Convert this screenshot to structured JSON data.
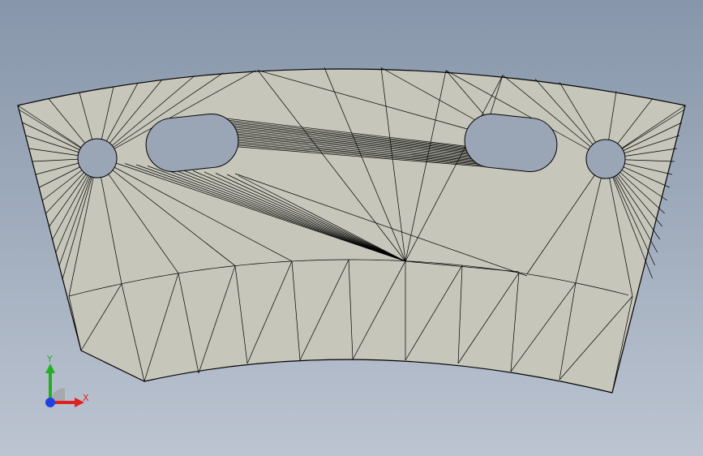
{
  "colors": {
    "background_top": "#8796aa",
    "background_bottom": "#bcc4d1",
    "part_face": "#c6c6bb",
    "mesh_edge": "#000000",
    "axis_x": "#e02020",
    "axis_y": "#20b020",
    "axis_z": "#2040e0"
  },
  "triad": {
    "x_label": "X",
    "y_label": "Y"
  },
  "model": {
    "name": "curved-plate-mesh",
    "features": [
      "round-hole-left",
      "slot-left",
      "slot-right",
      "round-hole-right"
    ],
    "display_mode": "wireframe-shaded"
  }
}
